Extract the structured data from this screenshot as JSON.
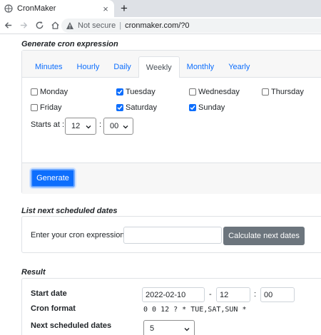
{
  "browser": {
    "tab_title": "CronMaker",
    "close_glyph": "×",
    "newtab_glyph": "+",
    "not_secure": "Not secure",
    "separator": "|",
    "url": "cronmaker.com/?0"
  },
  "generate": {
    "heading": "Generate cron expression",
    "tabs": [
      "Minutes",
      "Hourly",
      "Daily",
      "Weekly",
      "Monthly",
      "Yearly"
    ],
    "active_tab": "Weekly",
    "days": [
      {
        "label": "Monday",
        "checked": false
      },
      {
        "label": "Tuesday",
        "checked": true
      },
      {
        "label": "Wednesday",
        "checked": false
      },
      {
        "label": "Thursday",
        "checked": false
      },
      {
        "label": "Friday",
        "checked": false
      },
      {
        "label": "Saturday",
        "checked": true
      },
      {
        "label": "Sunday",
        "checked": true
      }
    ],
    "starts_at_label": "Starts at :",
    "hour": "12",
    "minute": "00",
    "colon": ":",
    "button": "Generate"
  },
  "list": {
    "heading": "List next scheduled dates",
    "label": "Enter your cron expression",
    "input_value": "",
    "button": "Calculate next dates"
  },
  "result": {
    "heading": "Result",
    "start_date_label": "Start date",
    "start_date": "2022-02-10",
    "dash": "-",
    "start_hour": "12",
    "colon": ":",
    "start_minute": "00",
    "cron_format_label": "Cron format",
    "cron_format": "0 0 12 ? * TUE,SAT,SUN *",
    "next_label": "Next scheduled dates",
    "next_count": "5"
  },
  "colors": {
    "primary": "#0d6efd",
    "secondary": "#6c757d"
  }
}
